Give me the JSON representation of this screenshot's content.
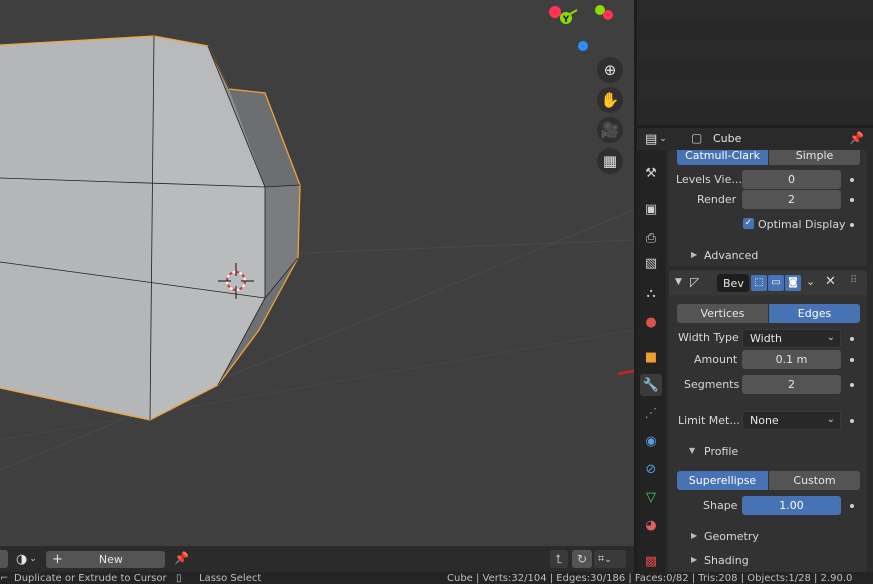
{
  "properties": {
    "object_name": "Cube",
    "subdivision": {
      "mode_options": [
        "Catmull-Clark",
        "Simple"
      ],
      "active_mode": "Catmull-Clark",
      "levels_viewport_label": "Levels Vie...",
      "levels_viewport_value": "0",
      "render_label": "Render",
      "render_value": "2",
      "optimal_display_label": "Optimal Display",
      "optimal_display_checked": true,
      "advanced_label": "Advanced"
    },
    "bevel": {
      "modifier_name": "Bev",
      "affect_options": [
        "Vertices",
        "Edges"
      ],
      "active_affect": "Edges",
      "width_type_label": "Width Type",
      "width_type_value": "Width",
      "amount_label": "Amount",
      "amount_value": "0.1 m",
      "segments_label": "Segments",
      "segments_value": "2",
      "limit_method_label": "Limit Met...",
      "limit_method_value": "None",
      "profile_label": "Profile",
      "profile_options": [
        "Superellipse",
        "Custom"
      ],
      "active_profile": "Superellipse",
      "shape_label": "Shape",
      "shape_value": "1.00",
      "geometry_label": "Geometry",
      "shading_label": "Shading"
    },
    "tabs": [
      "tool-icon",
      "render-icon",
      "output-icon",
      "view-layer-icon",
      "scene-icon",
      "world-icon",
      "object-icon",
      "modifier-icon",
      "particles-icon",
      "physics-icon",
      "constraints-icon",
      "data-icon",
      "material-icon",
      "texture-icon"
    ]
  },
  "bottom_header": {
    "new_label": "New"
  },
  "statusbar": {
    "left_hint": "Duplicate or Extrude to Cursor",
    "mid_hint": "Lasso Select",
    "stats": "Cube | Verts:32/104 | Edges:30/186 | Faces:0/82 | Tris:208 | Objects:1/28 | 2.90.0"
  },
  "colors": {
    "accent": "#4772b3",
    "selection_outline": "#f1a23b",
    "annotation_arrow": "#d42020",
    "gizmo_x": "#ff3352",
    "gizmo_y": "#8bdc00",
    "gizmo_z": "#2890ff"
  }
}
